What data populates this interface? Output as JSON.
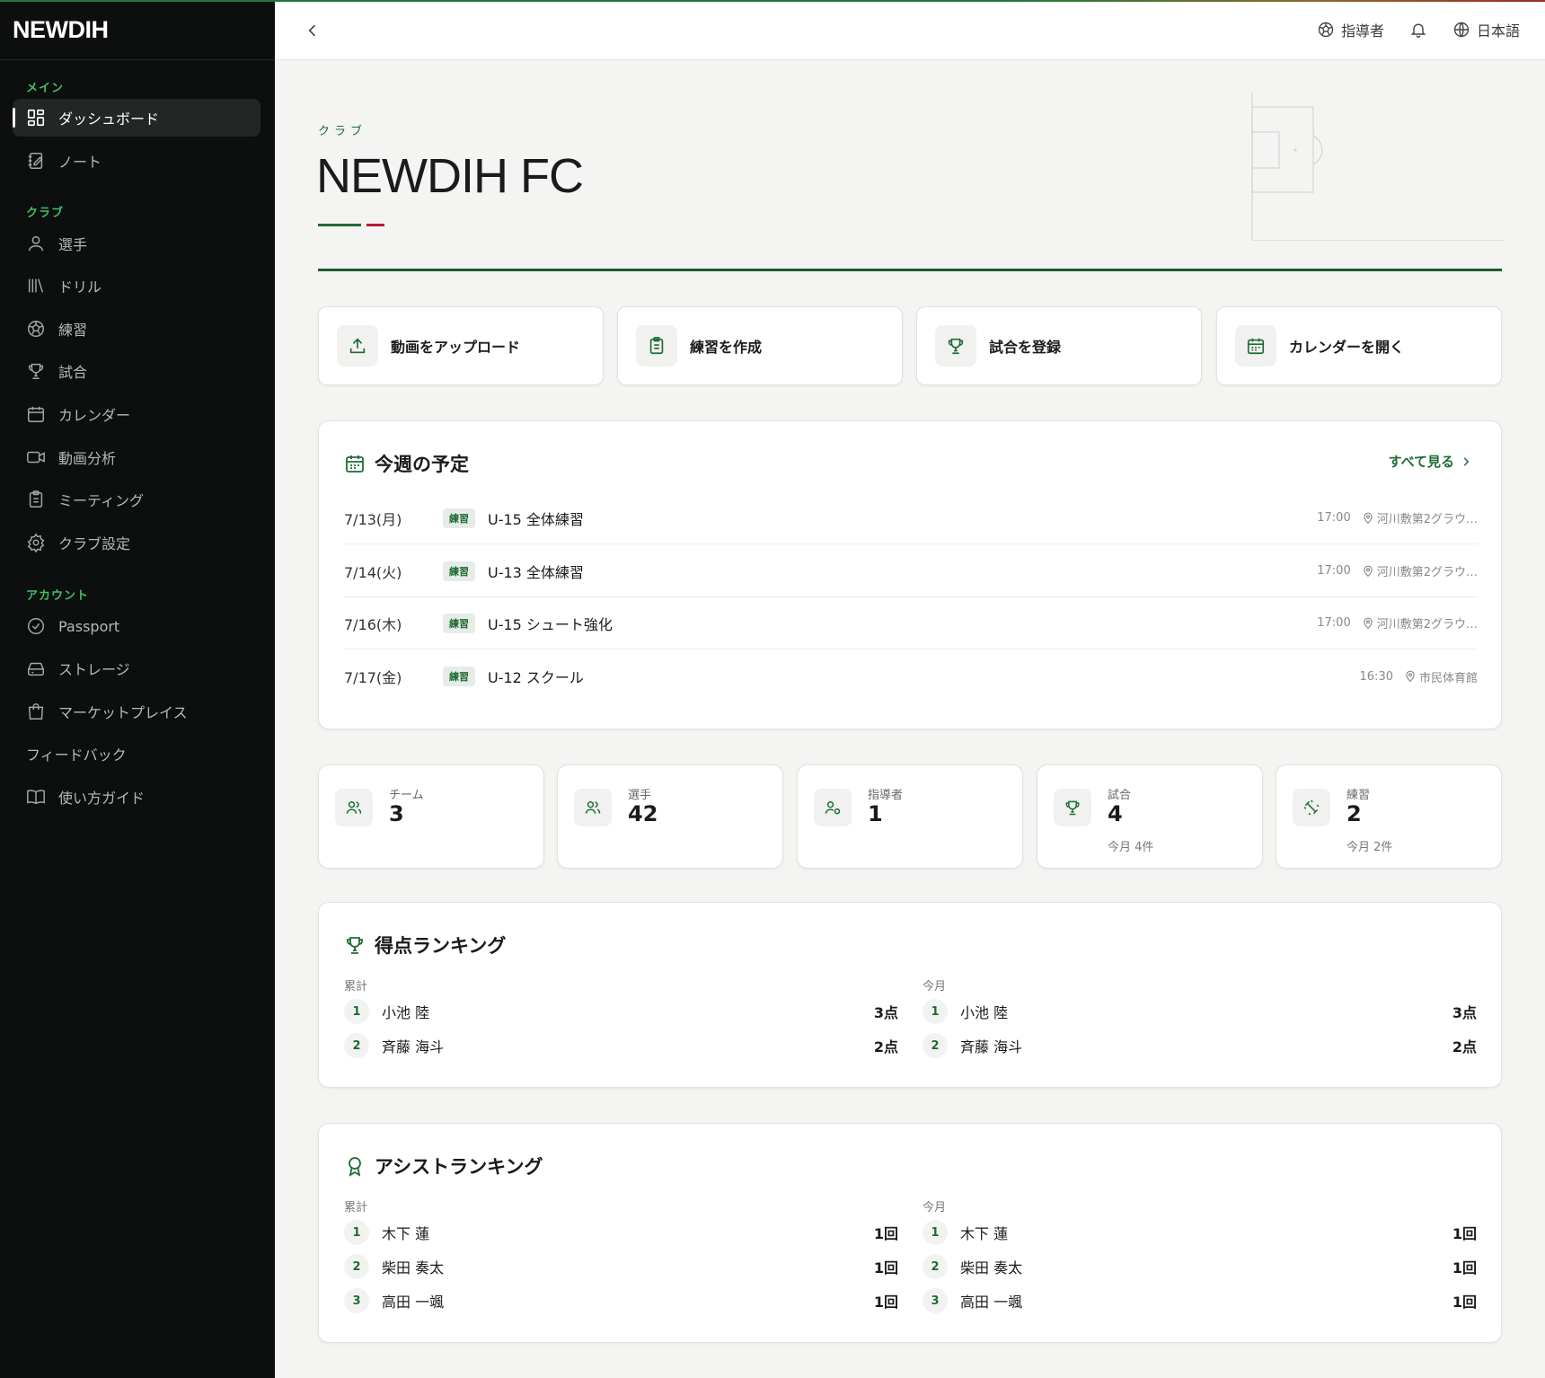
{
  "app": {
    "logo": "NEWDIH"
  },
  "sidebar": {
    "sections": [
      {
        "label": "メイン",
        "items": [
          {
            "label": "ダッシュボード",
            "icon": "dashboard-icon",
            "active": true
          },
          {
            "label": "ノート",
            "icon": "note-icon"
          }
        ]
      },
      {
        "label": "クラブ",
        "items": [
          {
            "label": "選手",
            "icon": "person-icon"
          },
          {
            "label": "ドリル",
            "icon": "library-icon"
          },
          {
            "label": "練習",
            "icon": "soccer-ball-icon"
          },
          {
            "label": "試合",
            "icon": "trophy-icon"
          },
          {
            "label": "カレンダー",
            "icon": "calendar-icon"
          },
          {
            "label": "動画分析",
            "icon": "video-icon"
          },
          {
            "label": "ミーティング",
            "icon": "clipboard-icon"
          },
          {
            "label": "クラブ設定",
            "icon": "gear-icon"
          }
        ]
      },
      {
        "label": "アカウント",
        "items": [
          {
            "label": "Passport",
            "icon": "badge-check-icon"
          },
          {
            "label": "ストレージ",
            "icon": "storage-icon"
          },
          {
            "label": "マーケットプレイス",
            "icon": "shopping-bag-icon"
          },
          {
            "label": "フィードバック",
            "icon": ""
          },
          {
            "label": "使い方ガイド",
            "icon": "book-icon"
          }
        ]
      }
    ]
  },
  "header": {
    "role": "指導者",
    "language": "日本語"
  },
  "hero": {
    "label": "クラブ",
    "club_name": "NEWDIH FC"
  },
  "quick_actions": [
    {
      "label": "動画をアップロード",
      "icon": "upload-icon"
    },
    {
      "label": "練習を作成",
      "icon": "clipboard-icon"
    },
    {
      "label": "試合を登録",
      "icon": "trophy-icon"
    },
    {
      "label": "カレンダーを開く",
      "icon": "calendar-icon"
    }
  ],
  "schedule": {
    "title": "今週の予定",
    "see_all": "すべて見る",
    "events": [
      {
        "date": "7/13(月)",
        "tag": "練習",
        "title": "U-15 全体練習",
        "time": "17:00",
        "location": "河川敷第2グラウ…"
      },
      {
        "date": "7/14(火)",
        "tag": "練習",
        "title": "U-13 全体練習",
        "time": "17:00",
        "location": "河川敷第2グラウ…"
      },
      {
        "date": "7/16(木)",
        "tag": "練習",
        "title": "U-15 シュート強化",
        "time": "17:00",
        "location": "河川敷第2グラウ…"
      },
      {
        "date": "7/17(金)",
        "tag": "練習",
        "title": "U-12 スクール",
        "time": "16:30",
        "location": "市民体育館"
      }
    ]
  },
  "stats": [
    {
      "label": "チーム",
      "value": "3",
      "sub": "",
      "icon": "users-icon"
    },
    {
      "label": "選手",
      "value": "42",
      "sub": "",
      "icon": "users-icon"
    },
    {
      "label": "指導者",
      "value": "1",
      "sub": "",
      "icon": "coach-icon"
    },
    {
      "label": "試合",
      "value": "4",
      "sub": "今月 4件",
      "icon": "trophy-icon"
    },
    {
      "label": "練習",
      "value": "2",
      "sub": "今月 2件",
      "icon": "dumbbell-icon"
    }
  ],
  "goal_ranking": {
    "title": "得点ランキング",
    "total_label": "累計",
    "month_label": "今月",
    "total": [
      {
        "rank": "1",
        "name": "小池 陸",
        "value": "3点"
      },
      {
        "rank": "2",
        "name": "斉藤 海斗",
        "value": "2点"
      }
    ],
    "month": [
      {
        "rank": "1",
        "name": "小池 陸",
        "value": "3点"
      },
      {
        "rank": "2",
        "name": "斉藤 海斗",
        "value": "2点"
      }
    ]
  },
  "assist_ranking": {
    "title": "アシストランキング",
    "total_label": "累計",
    "month_label": "今月",
    "total": [
      {
        "rank": "1",
        "name": "木下 蓮",
        "value": "1回"
      },
      {
        "rank": "2",
        "name": "柴田 奏太",
        "value": "1回"
      },
      {
        "rank": "3",
        "name": "高田 一颯",
        "value": "1回"
      }
    ],
    "month": [
      {
        "rank": "1",
        "name": "木下 蓮",
        "value": "1回"
      },
      {
        "rank": "2",
        "name": "柴田 奏太",
        "value": "1回"
      },
      {
        "rank": "3",
        "name": "高田 一颯",
        "value": "1回"
      }
    ]
  },
  "colors": {
    "accent_green": "#1e6b35",
    "accent_red": "#b31b3a",
    "sidebar_bg": "#0c0f0d",
    "section_label": "#3fbf6a"
  }
}
